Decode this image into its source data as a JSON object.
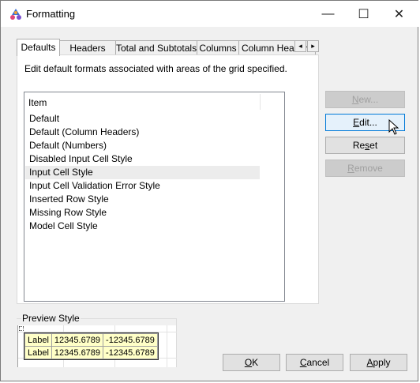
{
  "window": {
    "title": "Formatting"
  },
  "titlebar_controls": {
    "minimize": "—",
    "maximize": "☐",
    "close": "✕"
  },
  "tabs": [
    {
      "label": "Defaults",
      "active": true
    },
    {
      "label": "Headers",
      "active": false
    },
    {
      "label": "Total and Subtotals",
      "active": false
    },
    {
      "label": "Columns",
      "active": false
    },
    {
      "label": "Column Headers",
      "active": false
    }
  ],
  "tab_scroll": {
    "left": "◂",
    "right": "▸"
  },
  "description": "Edit default formats associated with areas of the grid specified.",
  "list": {
    "header": "Item",
    "items": [
      {
        "label": "Default",
        "selected": false
      },
      {
        "label": "Default (Column Headers)",
        "selected": false
      },
      {
        "label": "Default (Numbers)",
        "selected": false
      },
      {
        "label": "Disabled Input Cell Style",
        "selected": false
      },
      {
        "label": "Input Cell Style",
        "selected": true
      },
      {
        "label": "Input Cell Validation Error Style",
        "selected": false
      },
      {
        "label": "Inserted Row Style",
        "selected": false
      },
      {
        "label": "Missing Row Style",
        "selected": false
      },
      {
        "label": "Model Cell Style",
        "selected": false
      }
    ]
  },
  "side_buttons": {
    "new_key": "N",
    "new_rest": "ew...",
    "edit_key": "E",
    "edit_rest": "dit...",
    "reset_pre": "Re",
    "reset_key": "s",
    "reset_rest": "et",
    "remove_key": "R",
    "remove_rest": "emove"
  },
  "preview": {
    "label": "Preview Style",
    "rows": [
      [
        "Label",
        "12345.6789",
        "-12345.6789"
      ],
      [
        "Label",
        "12345.6789",
        "-12345.6789"
      ]
    ]
  },
  "bottom_buttons": {
    "ok_key": "O",
    "ok_rest": "K",
    "cancel_key": "C",
    "cancel_rest": "ancel",
    "apply_key": "A",
    "apply_rest": "pply"
  },
  "colors": {
    "accent": "#0078d7",
    "preview_bg": "#ffffc7",
    "selected_row": "#ececec"
  }
}
